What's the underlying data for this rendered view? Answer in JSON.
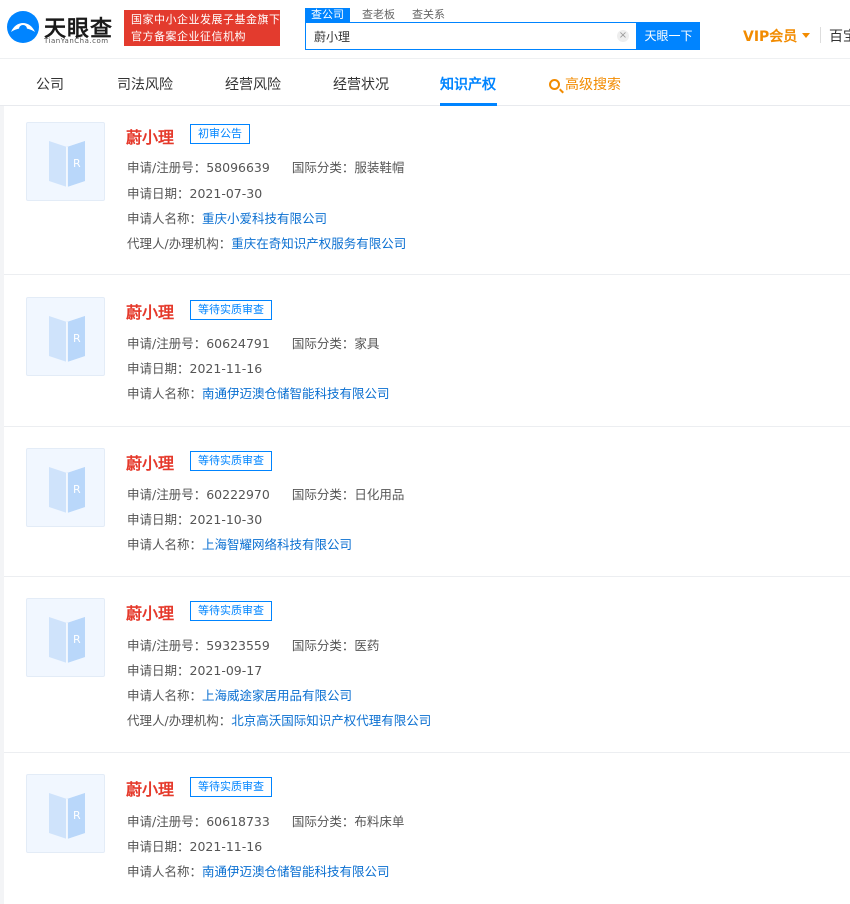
{
  "brand": {
    "name": "天眼查",
    "sub": "TianYanCha.com",
    "slogan_line1": "国家中小企业发展子基金旗下",
    "slogan_line2": "官方备案企业征信机构"
  },
  "search": {
    "tabs": [
      "查公司",
      "查老板",
      "查关系"
    ],
    "query": "蔚小理",
    "clear": "×",
    "button": "天眼一下"
  },
  "header_right": {
    "vip": "VIP会员",
    "baibao": "百宝"
  },
  "nav": {
    "items": [
      "公司",
      "司法风险",
      "经营风险",
      "经营状况",
      "知识产权"
    ],
    "advanced": "高级搜索",
    "active": "知识产权"
  },
  "labels": {
    "reg_no": "申请/注册号：",
    "intl_class": "国际分类：",
    "apply_date": "申请日期：",
    "applicant": "申请人名称：",
    "agent": "代理人/办理机构："
  },
  "results": [
    {
      "name": "蔚小理",
      "status": "初审公告",
      "reg_no": "58096639",
      "intl_class": "服装鞋帽",
      "apply_date": "2021-07-30",
      "applicant": "重庆小爱科技有限公司",
      "agent": "重庆在奇知识产权服务有限公司"
    },
    {
      "name": "蔚小理",
      "status": "等待实质审查",
      "reg_no": "60624791",
      "intl_class": "家具",
      "apply_date": "2021-11-16",
      "applicant": "南通伊迈澳仓储智能科技有限公司",
      "agent": ""
    },
    {
      "name": "蔚小理",
      "status": "等待实质审查",
      "reg_no": "60222970",
      "intl_class": "日化用品",
      "apply_date": "2021-10-30",
      "applicant": "上海智耀网络科技有限公司",
      "agent": ""
    },
    {
      "name": "蔚小理",
      "status": "等待实质审查",
      "reg_no": "59323559",
      "intl_class": "医药",
      "apply_date": "2021-09-17",
      "applicant": "上海威途家居用品有限公司",
      "agent": "北京高沃国际知识产权代理有限公司"
    },
    {
      "name": "蔚小理",
      "status": "等待实质审查",
      "reg_no": "60618733",
      "intl_class": "布料床单",
      "apply_date": "2021-11-16",
      "applicant": "南通伊迈澳仓储智能科技有限公司",
      "agent": ""
    }
  ],
  "colors": {
    "accent": "#0084ff",
    "title_red": "#e5392b",
    "vip_orange": "#f28b00",
    "slogan_red": "#e33b2e"
  }
}
